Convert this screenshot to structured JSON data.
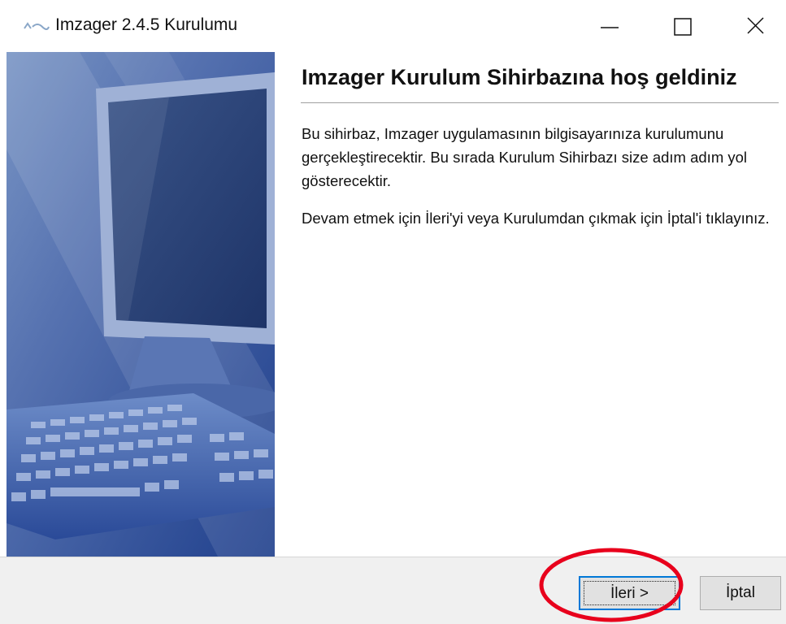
{
  "window": {
    "title": "Imzager 2.4.5 Kurulumu"
  },
  "titlebar_buttons": {
    "minimize_icon": "minimize-icon",
    "maximize_icon": "maximize-icon",
    "close_icon": "close-icon"
  },
  "wizard": {
    "heading": "Imzager Kurulum Sihirbazına hoş geldiniz",
    "paragraph1": "Bu sihirbaz, Imzager uygulamasının bilgisayarınıza kurulumunu gerçekleştirecektir. Bu sırada Kurulum Sihirbazı size adım adım yol gösterecektir.",
    "paragraph2": "Devam etmek için İleri'yi veya Kurulumdan çıkmak için İptal'i tıklayınız."
  },
  "buttons": {
    "next_label": "İleri >",
    "cancel_label": "İptal"
  },
  "colors": {
    "accent": "#0078d7",
    "highlight": "#e8001c",
    "panel": "#f0f0f0"
  }
}
